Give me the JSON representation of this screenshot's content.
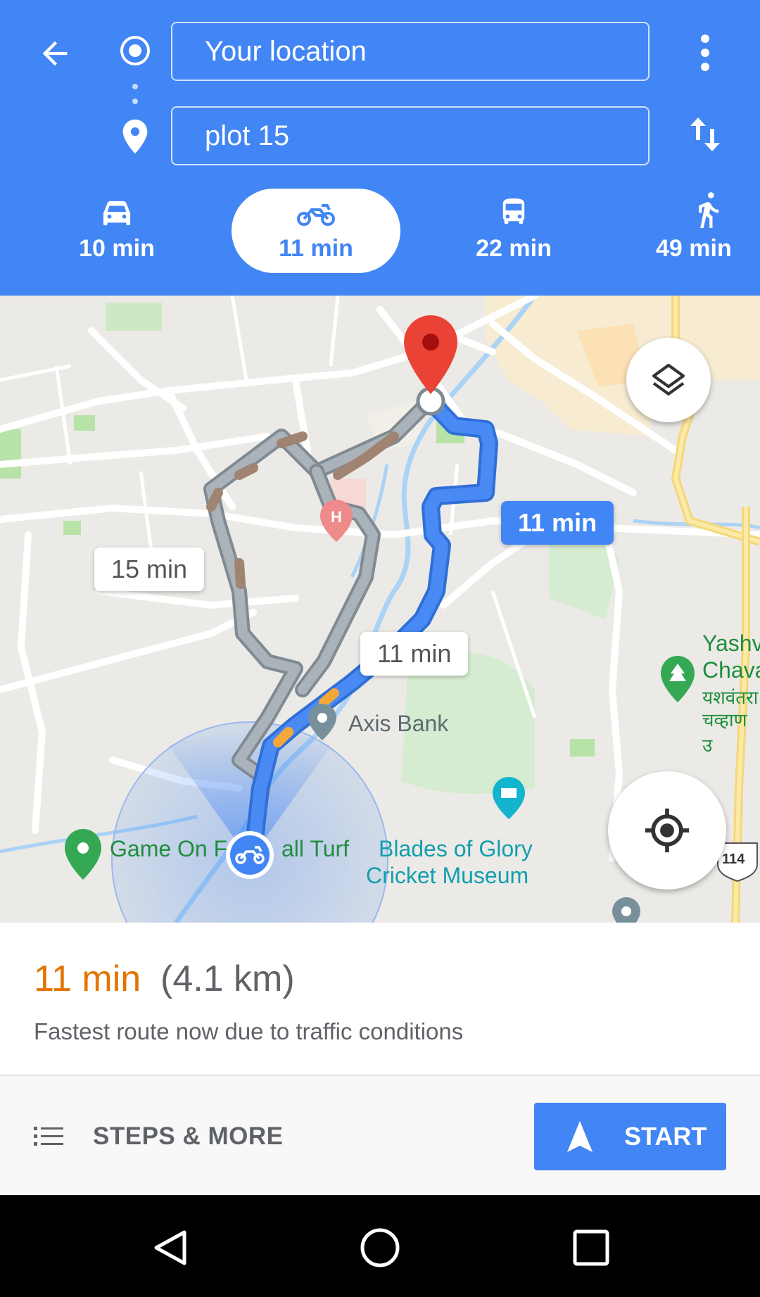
{
  "directions": {
    "origin_value": "Your location",
    "destination_value": "plot 15"
  },
  "modes": [
    {
      "name": "drive",
      "time": "10 min",
      "icon": "car-icon"
    },
    {
      "name": "motorcycle",
      "time": "11 min",
      "icon": "motorcycle-icon",
      "selected": true
    },
    {
      "name": "transit",
      "time": "22 min",
      "icon": "bus-icon"
    },
    {
      "name": "walk",
      "time": "49 min",
      "icon": "walk-icon"
    }
  ],
  "map": {
    "route_bubbles": {
      "primary": "11 min",
      "alt_left": "15 min",
      "alt_mid": "11 min"
    },
    "places": {
      "axis_bank": "Axis Bank",
      "game_on": "Game On F",
      "game_on_end": "all Turf",
      "blades_line1": "Blades of Glory",
      "blades_line2": "Cricket Museum",
      "yash_line1": "Yashv",
      "yash_line2": "Chava",
      "yash_dev1": "यशवंतरा",
      "yash_dev2": "चव्हाण उ",
      "highway": "114"
    }
  },
  "summary": {
    "duration": "11 min",
    "distance": "(4.1 km)",
    "note": "Fastest route now due to traffic conditions"
  },
  "actions": {
    "steps_label": "STEPS & MORE",
    "start_label": "START"
  },
  "colors": {
    "primary": "#4285f4",
    "duration": "#e37400",
    "destination_pin": "#ea4335"
  }
}
